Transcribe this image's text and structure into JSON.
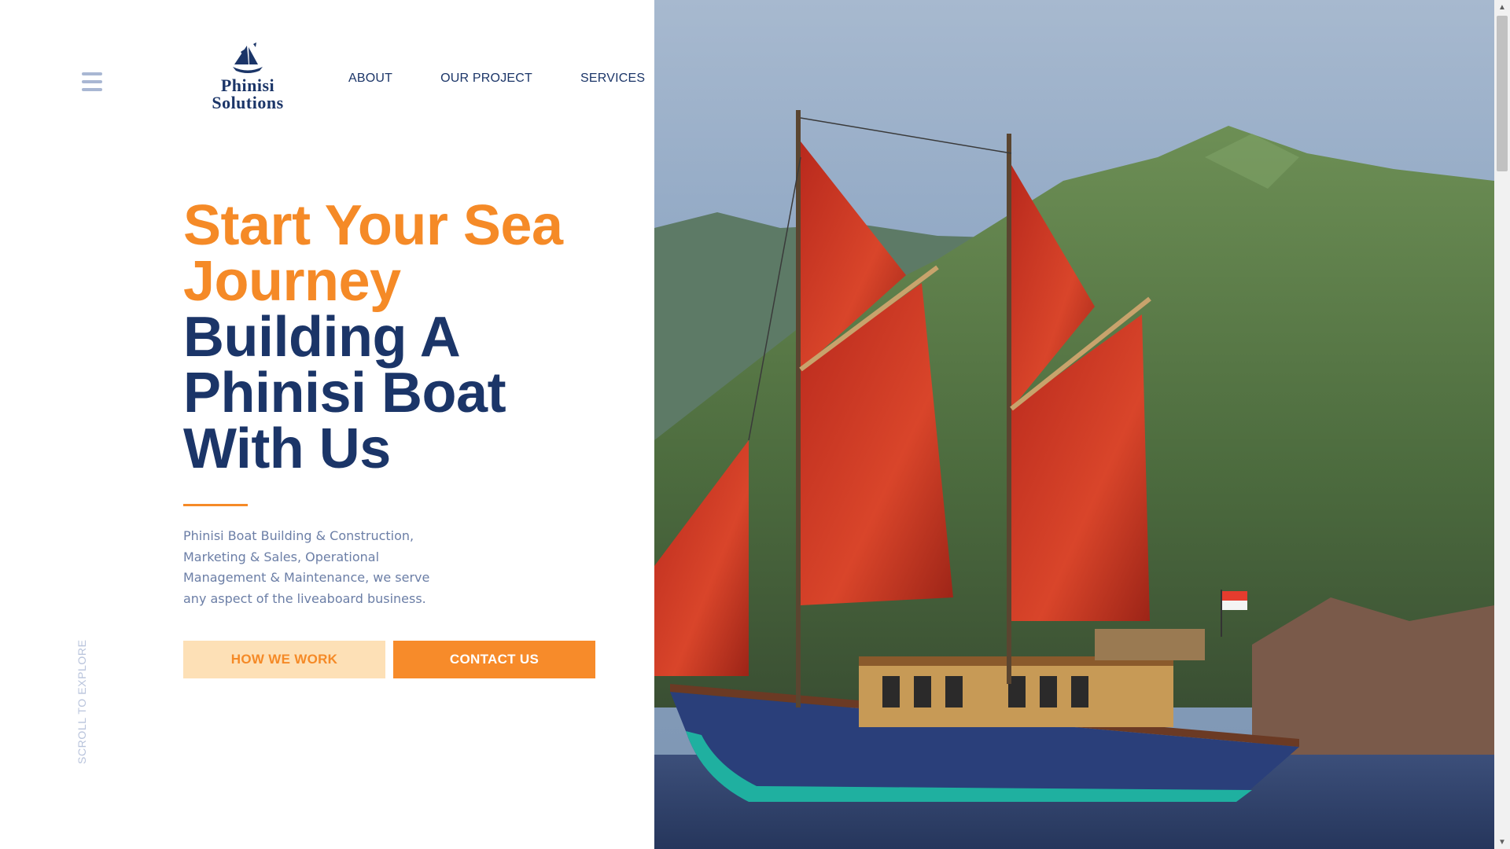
{
  "header": {
    "menu_icon": "hamburger-menu-icon",
    "logo": {
      "line1": "Phinisi",
      "line2": "Solutions",
      "icon": "ship-sail-logo-icon"
    },
    "nav": [
      {
        "label": "ABOUT"
      },
      {
        "label": "OUR PROJECT"
      },
      {
        "label": "SERVICES"
      }
    ]
  },
  "hero": {
    "headline_orange_1": "Start Your Sea",
    "headline_orange_2": "Journey",
    "headline_navy_1": "Building A",
    "headline_navy_2": "Phinisi Boat",
    "headline_navy_3": "With Us",
    "description": "Phinisi Boat Building & Construction, Marketing & Sales, Operational Management & Maintenance, we serve any aspect of the liveaboard business.",
    "buttons": {
      "how_we_work": "HOW WE WORK",
      "contact_us": "CONTACT US"
    },
    "scroll_hint": "SCROLL TO EXPLORE",
    "image": "phinisi-boat-red-sails-photo"
  },
  "colors": {
    "orange": "#f58a27",
    "navy": "#1b3568",
    "light_orange": "#fde0b6",
    "muted_text": "#6b7ea6"
  }
}
